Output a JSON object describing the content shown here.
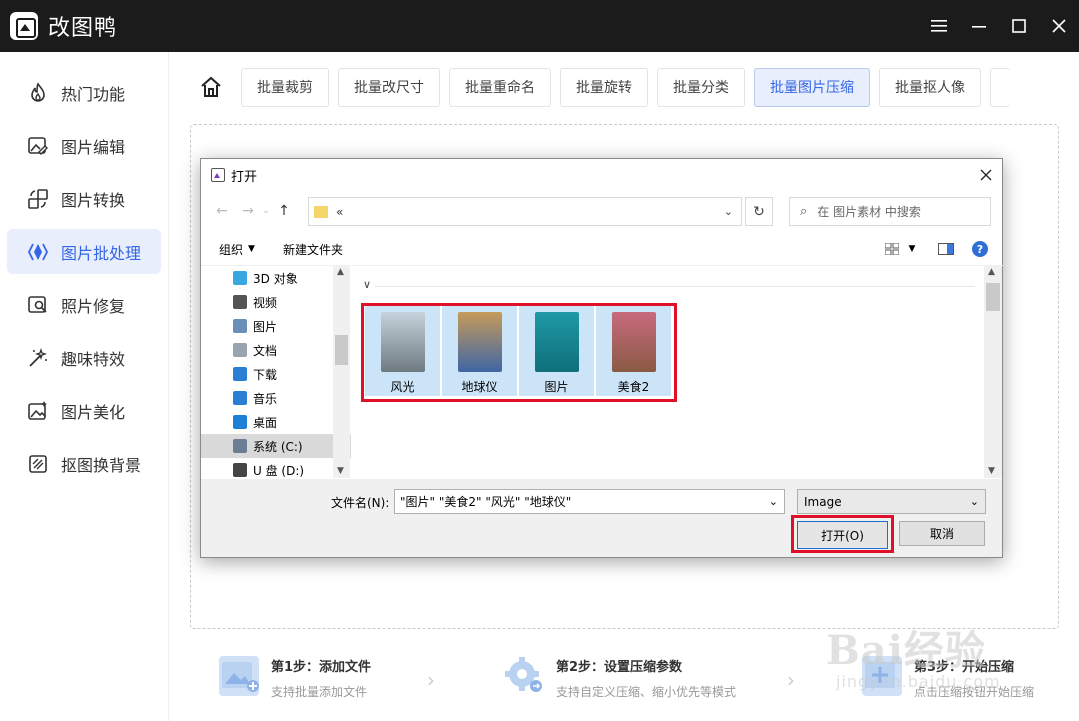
{
  "app": {
    "title": "改图鸭"
  },
  "sidebar": {
    "items": [
      {
        "label": "热门功能",
        "icon": "fire-icon",
        "active": false
      },
      {
        "label": "图片编辑",
        "icon": "image-edit-icon",
        "active": false
      },
      {
        "label": "图片转换",
        "icon": "convert-icon",
        "active": false
      },
      {
        "label": "图片批处理",
        "icon": "batch-icon",
        "active": true
      },
      {
        "label": "照片修复",
        "icon": "photo-repair-icon",
        "active": false
      },
      {
        "label": "趣味特效",
        "icon": "magic-wand-icon",
        "active": false
      },
      {
        "label": "图片美化",
        "icon": "beautify-icon",
        "active": false
      },
      {
        "label": "抠图换背景",
        "icon": "cutout-icon",
        "active": false
      }
    ]
  },
  "toolbar": {
    "tools": [
      "批量裁剪",
      "批量改尺寸",
      "批量重命名",
      "批量旋转",
      "批量分类",
      "批量图片压缩",
      "批量抠人像"
    ],
    "active_index": 5
  },
  "steps": [
    {
      "title": "第1步：添加文件",
      "desc": "支持批量添加文件"
    },
    {
      "title": "第2步：设置压缩参数",
      "desc": "支持自定义压缩、缩小优先等模式"
    },
    {
      "title": "第3步：开始压缩",
      "desc": "点击压缩按钮开始压缩"
    }
  ],
  "dialog": {
    "title": "打开",
    "address_crumb": "«",
    "search_placeholder": "在 图片素材 中搜索",
    "organize_label": "组织",
    "new_folder_label": "新建文件夹",
    "help_label": "?",
    "tree": [
      {
        "label": "3D 对象",
        "color": "#36a7e0",
        "selected": false
      },
      {
        "label": "视频",
        "color": "#555555",
        "selected": false
      },
      {
        "label": "图片",
        "color": "#6a8fb8",
        "selected": false
      },
      {
        "label": "文档",
        "color": "#9aa4b0",
        "selected": false
      },
      {
        "label": "下载",
        "color": "#2a7fd4",
        "selected": false
      },
      {
        "label": "音乐",
        "color": "#2a7fd4",
        "selected": false
      },
      {
        "label": "桌面",
        "color": "#1e7fd8",
        "selected": false
      },
      {
        "label": "系统 (C:)",
        "color": "#6b7e93",
        "selected": true
      },
      {
        "label": "U 盘 (D:)",
        "color": "#444444",
        "selected": false
      }
    ],
    "files": [
      {
        "name": "风光",
        "colors": [
          "#c7d3dc",
          "#6e7a80"
        ]
      },
      {
        "name": "地球仪",
        "colors": [
          "#c59a5a",
          "#3f66a4"
        ]
      },
      {
        "name": "图片",
        "colors": [
          "#1e9aa6",
          "#0f6f7a"
        ]
      },
      {
        "name": "美食2",
        "colors": [
          "#c86a7e",
          "#8a5a44"
        ]
      }
    ],
    "filename_label": "文件名(N):",
    "filename_value": "\"图片\" \"美食2\" \"风光\" \"地球仪\"",
    "filetype_value": "Image",
    "open_button": "打开(O)",
    "cancel_button": "取消"
  },
  "watermark": {
    "text": "Bai经验",
    "sub": "jingyan.baidu.com"
  }
}
